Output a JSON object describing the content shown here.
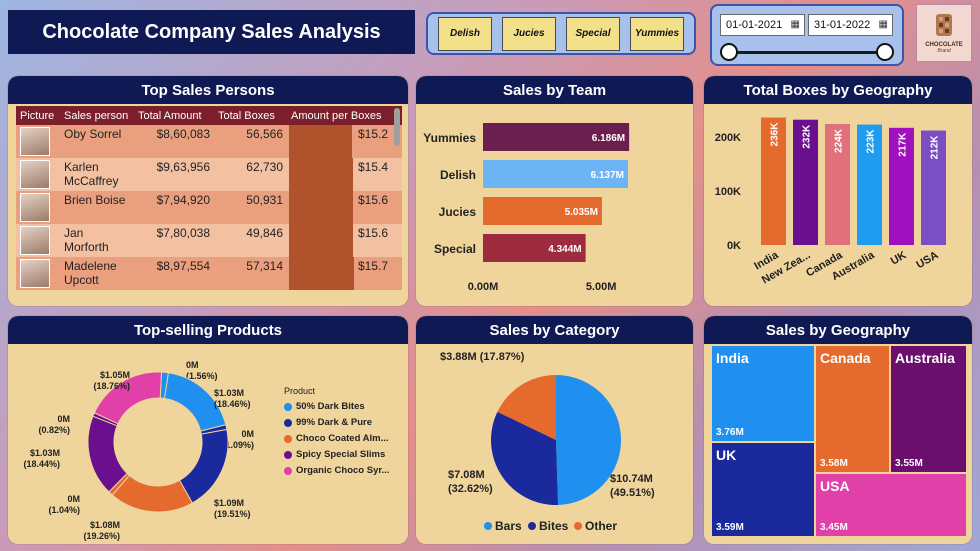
{
  "header": {
    "title": "Chocolate Company Sales Analysis",
    "team_buttons": [
      "Delish",
      "Jucies",
      "Special",
      "Yummies"
    ],
    "date_start": "01-01-2021",
    "date_end": "31-01-2022",
    "logo_text": "CHOCOLATE",
    "logo_sub": "Brand"
  },
  "top_sales_persons": {
    "title": "Top Sales Persons",
    "columns": [
      "Picture",
      "Sales person",
      "Total Amount",
      "Total Boxes",
      "Amount per Boxes"
    ],
    "rows": [
      {
        "name": "Oby Sorrel",
        "amount": "$8,60,083",
        "boxes": "56,566",
        "apb": "$15.2",
        "apb_value": 15.2
      },
      {
        "name": "Karlen McCaffrey",
        "amount": "$9,63,956",
        "boxes": "62,730",
        "apb": "$15.4",
        "apb_value": 15.4
      },
      {
        "name": "Brien Boise",
        "amount": "$7,94,920",
        "boxes": "50,931",
        "apb": "$15.6",
        "apb_value": 15.6
      },
      {
        "name": "Jan Morforth",
        "amount": "$7,80,038",
        "boxes": "49,846",
        "apb": "$15.6",
        "apb_value": 15.6
      },
      {
        "name": "Madelene Upcott",
        "amount": "$8,97,554",
        "boxes": "57,314",
        "apb": "$15.7",
        "apb_value": 15.7
      }
    ]
  },
  "sales_by_team": {
    "title": "Sales by Team",
    "chart_data": {
      "type": "bar",
      "orientation": "horizontal",
      "categories": [
        "Yummies",
        "Delish",
        "Jucies",
        "Special"
      ],
      "values": [
        6.186,
        6.137,
        5.035,
        4.344
      ],
      "labels": [
        "6.186M",
        "6.137M",
        "5.035M",
        "4.344M"
      ],
      "colors": [
        "#6b1f4e",
        "#6db4f5",
        "#e46a2d",
        "#9c2c3e"
      ],
      "xticks": [
        "0.00M",
        "5.00M"
      ],
      "xlim": [
        0,
        6.9
      ]
    }
  },
  "boxes_by_geography": {
    "title": "Total Boxes by Geography",
    "chart_data": {
      "type": "bar",
      "categories": [
        "India",
        "New Zea...",
        "Canada",
        "Australia",
        "UK",
        "USA"
      ],
      "values": [
        236,
        232,
        224,
        223,
        217,
        212
      ],
      "labels": [
        "236K",
        "232K",
        "224K",
        "223K",
        "217K",
        "212K"
      ],
      "colors": [
        "#e46a2d",
        "#6a0f8e",
        "#e0707a",
        "#1f9cf0",
        "#a00fc0",
        "#7a4fc4"
      ],
      "yticks": [
        "0K",
        "100K",
        "200K"
      ],
      "ylim": [
        0,
        250
      ]
    }
  },
  "top_selling_products": {
    "title": "Top-selling Products",
    "legend_title": "Product",
    "chart_data": {
      "type": "pie",
      "variant": "donut",
      "series": [
        {
          "name": "50% Dark Bites",
          "color": "#1f8ff0"
        },
        {
          "name": "99% Dark & Pure",
          "color": "#1a2a9c"
        },
        {
          "name": "Choco Coated Alm...",
          "color": "#e46a2d"
        },
        {
          "name": "Spicy Special Slims",
          "color": "#6a0f8e"
        },
        {
          "name": "Organic Choco Syr...",
          "color": "#e040a8"
        }
      ],
      "slices": [
        {
          "color": "#1f8ff0",
          "value": 1.56,
          "label": "0M (1.56%)"
        },
        {
          "color": "#1f8ff0",
          "value": 18.46,
          "label": "$1.03M (18.46%)"
        },
        {
          "color": "#1a2a9c",
          "value": 1.09,
          "label": "0M (1.09%)"
        },
        {
          "color": "#1a2a9c",
          "value": 19.51,
          "label": "$1.09M (19.51%)"
        },
        {
          "color": "#e46a2d",
          "value": 19.26,
          "label": "$1.08M (19.26%)"
        },
        {
          "color": "#e46a2d",
          "value": 1.04,
          "label": "0M (1.04%)"
        },
        {
          "color": "#6a0f8e",
          "value": 18.44,
          "label": "$1.03M (18.44%)"
        },
        {
          "color": "#6a0f8e",
          "value": 0.82,
          "label": "0M (0.82%)"
        },
        {
          "color": "#e040a8",
          "value": 18.76,
          "label": "$1.05M (18.76%)"
        }
      ]
    }
  },
  "sales_by_category": {
    "title": "Sales by Category",
    "chart_data": {
      "type": "pie",
      "categories": [
        "Bars",
        "Bites",
        "Other"
      ],
      "values": [
        49.51,
        32.62,
        17.87
      ],
      "amounts": [
        "$10.74M",
        "$7.08M",
        "$3.88M"
      ],
      "labels": [
        "$10.74M (49.51%)",
        "$7.08M (32.62%)",
        "$3.88M (17.87%)"
      ],
      "colors": [
        "#1f8ff0",
        "#1a2a9c",
        "#e46a2d"
      ]
    }
  },
  "sales_by_geography": {
    "title": "Sales by Geography",
    "tiles": [
      {
        "name": "India",
        "value": "3.76M",
        "color": "#1f8ff0"
      },
      {
        "name": "UK",
        "value": "3.59M",
        "color": "#1a2a9c"
      },
      {
        "name": "Canada",
        "value": "3.58M",
        "color": "#e46a2d"
      },
      {
        "name": "Australia",
        "value": "3.55M",
        "color": "#6a0f6e"
      },
      {
        "name": "USA",
        "value": "3.45M",
        "color": "#e040a8"
      }
    ]
  }
}
